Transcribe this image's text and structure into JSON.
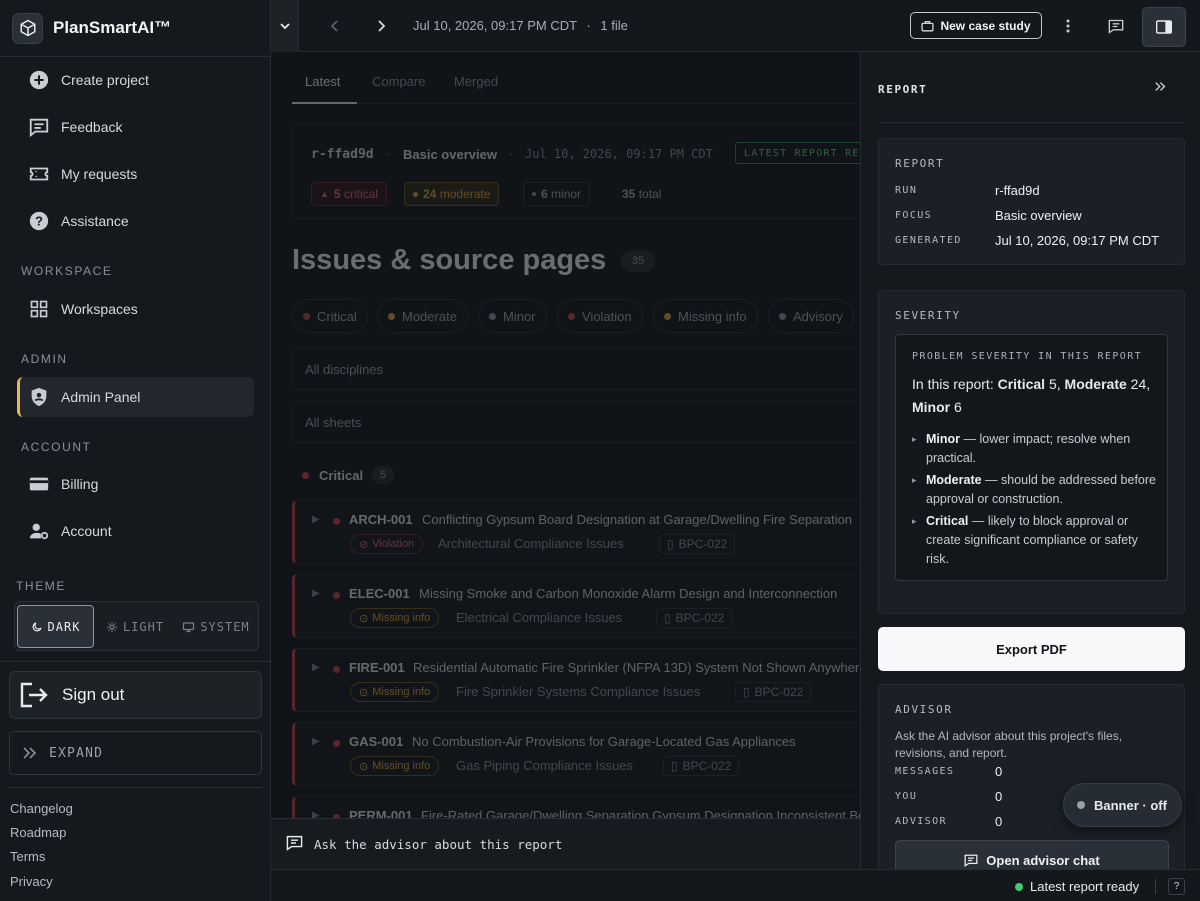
{
  "app": {
    "name": "PlanSmartAI™"
  },
  "sidebar": {
    "nav": [
      {
        "label": "Create project",
        "icon": "plus-circle-icon"
      },
      {
        "label": "Feedback",
        "icon": "feedback-icon"
      },
      {
        "label": "My requests",
        "icon": "ticket-icon"
      },
      {
        "label": "Assistance",
        "icon": "help-circle-icon"
      }
    ],
    "workspace_title": "WORKSPACE",
    "workspaces_label": "Workspaces",
    "admin_title": "ADMIN",
    "admin_panel_label": "Admin Panel",
    "account_title": "ACCOUNT",
    "billing_label": "Billing",
    "account_label": "Account",
    "theme_title": "THEME",
    "theme_options": [
      "DARK",
      "LIGHT",
      "SYSTEM"
    ],
    "theme_selected": "DARK",
    "signout_label": "Sign out",
    "expand_label": "EXPAND",
    "footer_links": [
      "Changelog",
      "Roadmap",
      "Terms",
      "Privacy"
    ]
  },
  "topbar": {
    "timestamp": "Jul 10, 2026, 09:17 PM CDT",
    "separator": "·",
    "files": "1 file",
    "new_case_label": "New case study"
  },
  "main": {
    "tabs": [
      "Latest",
      "Compare",
      "Merged"
    ],
    "active_tab": "Latest",
    "report_card": {
      "run_id": "r-ffad9d",
      "focus": "Basic overview",
      "generated": "Jul 10, 2026, 09:17 PM CDT",
      "status": "LATEST REPORT REA",
      "critical_count": "5",
      "critical_label": "critical",
      "moderate_count": "24",
      "moderate_label": "moderate",
      "minor_count": "6",
      "minor_label": "minor",
      "total_count": "35",
      "total_label": "total"
    },
    "issues_heading": "Issues & source pages",
    "issues_count": "35",
    "filters": [
      {
        "label": "Critical",
        "color": "#c0424a"
      },
      {
        "label": "Moderate",
        "color": "#d4a13a"
      },
      {
        "label": "Minor",
        "color": "#8a9098"
      },
      {
        "label": "Violation",
        "color": "#c0424a"
      },
      {
        "label": "Missing info",
        "color": "#d4a13a"
      },
      {
        "label": "Advisory",
        "color": "#8a9098"
      }
    ],
    "discipline_select": "All disciplines",
    "sheet_select": "All sheets",
    "group_label": "Critical",
    "group_count": "5",
    "issues": [
      {
        "code": "ARCH-001",
        "title": "Conflicting Gypsum Board Designation at Garage/Dwelling Fire Separation",
        "tag": "Violation",
        "category": "Architectural Compliance Issues",
        "source": "BPC-022"
      },
      {
        "code": "ELEC-001",
        "title": "Missing Smoke and Carbon Monoxide Alarm Design and Interconnection",
        "tag": "Missing info",
        "category": "Electrical Compliance Issues",
        "source": "BPC-022"
      },
      {
        "code": "FIRE-001",
        "title": "Residential Automatic Fire Sprinkler (NFPA 13D) System Not Shown Anywhere",
        "tag": "Missing info",
        "category": "Fire Sprinkler Systems Compliance Issues",
        "source": "BPC-022"
      },
      {
        "code": "GAS-001",
        "title": "No Combustion-Air Provisions for Garage-Located Gas Appliances",
        "tag": "Missing info",
        "category": "Gas Piping Compliance Issues",
        "source": "BPC-022"
      },
      {
        "code": "PERM-001",
        "title": "Fire-Rated Garage/Dwelling Separation Gypsum Designation Inconsistent Be",
        "tag": "",
        "category": "",
        "source": ""
      }
    ],
    "ask_placeholder": "Ask the advisor about this report"
  },
  "panel": {
    "header": "REPORT",
    "report_box": {
      "title": "REPORT",
      "run_label": "RUN",
      "run_value": "r-ffad9d",
      "focus_label": "FOCUS",
      "focus_value": "Basic overview",
      "generated_label": "GENERATED",
      "generated_value": "Jul 10, 2026, 09:17 PM CDT"
    },
    "severity_box": {
      "title": "SEVERITY",
      "caption": "PROBLEM SEVERITY IN THIS REPORT",
      "intro": "In this report:",
      "critical_label": "Critical",
      "critical_value": "5",
      "moderate_label": "Moderate",
      "moderate_value": "24",
      "minor_label": "Minor",
      "minor_value": "6",
      "items": [
        {
          "term": "Minor",
          "desc": " — lower impact; resolve when practical."
        },
        {
          "term": "Moderate",
          "desc": " — should be addressed before approval or construction."
        },
        {
          "term": "Critical",
          "desc": " — likely to block approval or create significant compliance or safety risk."
        }
      ]
    },
    "export_label": "Export PDF",
    "advisor_box": {
      "title": "ADVISOR",
      "description": "Ask the AI advisor about this project's files, revisions, and report.",
      "messages_label": "MESSAGES",
      "messages_value": "0",
      "you_label": "YOU",
      "you_value": "0",
      "advisor_label": "ADVISOR",
      "advisor_value": "0",
      "open_chat_label": "Open advisor chat"
    },
    "banner_label": "Banner · off"
  },
  "statusbar": {
    "ready_label": "Latest report ready",
    "help_label": "?"
  }
}
